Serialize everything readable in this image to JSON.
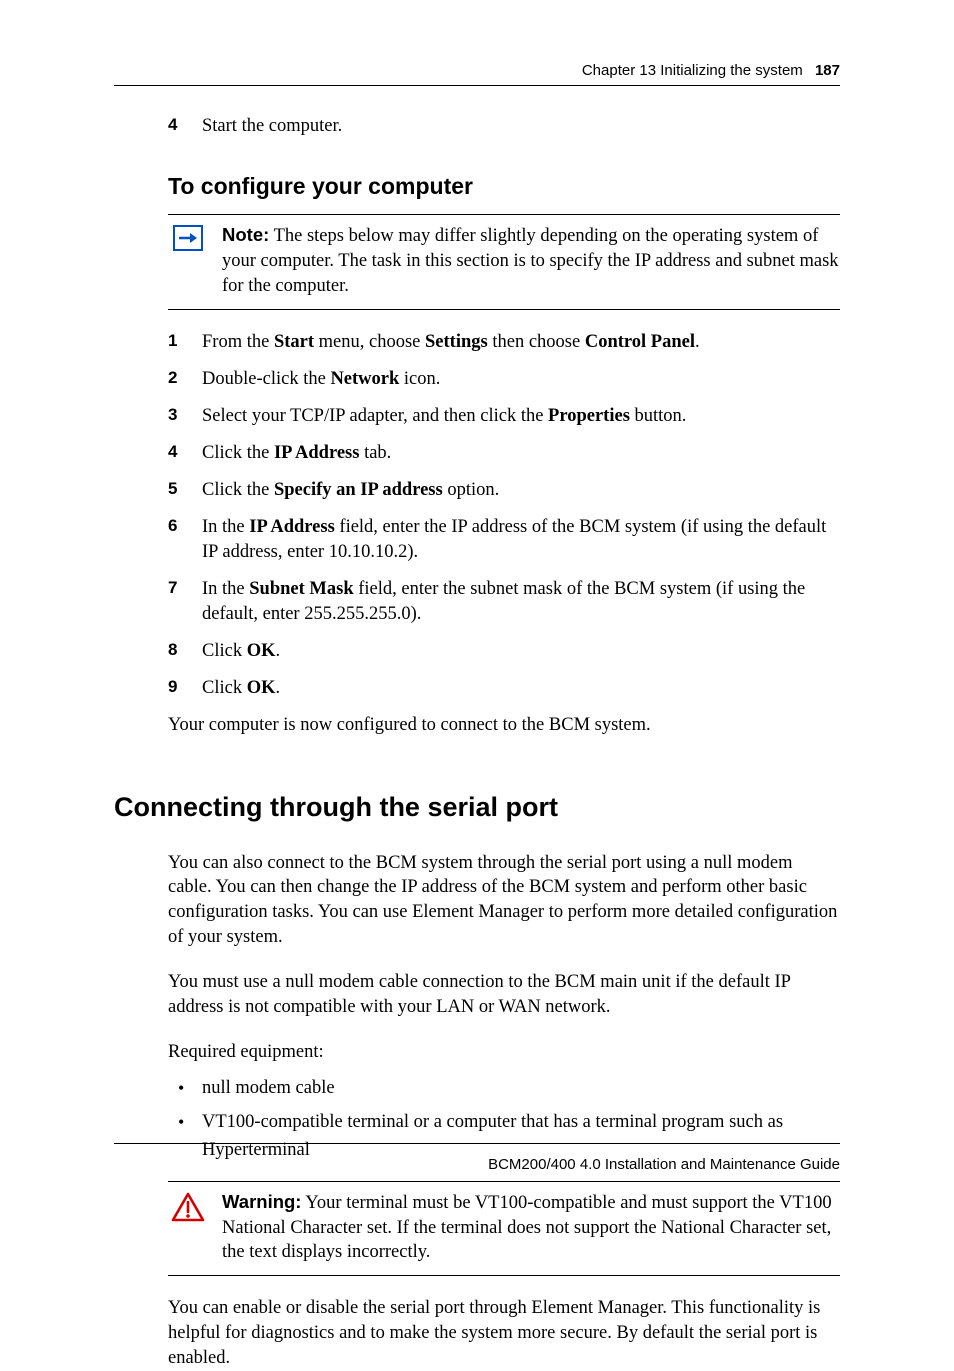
{
  "header": {
    "chapter": "Chapter 13  Initializing the system",
    "page_number": "187"
  },
  "pre_step": {
    "num": "4",
    "text": "Start the computer."
  },
  "section_configure": {
    "title": "To configure your computer",
    "note_lead": "Note:",
    "note_body": " The steps below may differ slightly depending on the operating system of your computer. The task in this section is to specify the IP address and subnet mask for the computer.",
    "steps": [
      {
        "num": "1",
        "pre": "From the ",
        "b1": "Start",
        "mid1": " menu, choose ",
        "b2": "Settings",
        "mid2": " then choose ",
        "b3": "Control Panel",
        "post": "."
      },
      {
        "num": "2",
        "pre": "Double-click the ",
        "b1": "Network",
        "post": " icon."
      },
      {
        "num": "3",
        "pre": "Select your TCP/IP adapter, and then click the ",
        "b1": "Properties",
        "post": " button."
      },
      {
        "num": "4",
        "pre": "Click the ",
        "b1": "IP Address",
        "post": " tab."
      },
      {
        "num": "5",
        "pre": "Click the ",
        "b1": "Specify an IP address",
        "post": " option."
      },
      {
        "num": "6",
        "pre": "In the ",
        "b1": "IP Address",
        "post": " field, enter the IP address of the BCM system (if using the default IP address, enter 10.10.10.2)."
      },
      {
        "num": "7",
        "pre": "In the ",
        "b1": "Subnet Mask",
        "post": " field, enter the subnet mask of the BCM system (if using the default, enter 255.255.255.0)."
      },
      {
        "num": "8",
        "pre": "Click ",
        "b1": "OK",
        "post": "."
      },
      {
        "num": "9",
        "pre": "Click ",
        "b1": "OK",
        "post": "."
      }
    ],
    "closing": "Your computer is now configured to connect to the BCM system."
  },
  "section_serial": {
    "title": "Connecting through the serial port",
    "p1": "You can also connect to the BCM system through the serial port using a null modem cable. You can then change the IP address of the BCM system and perform other basic configuration tasks. You can use Element Manager to perform more detailed configuration of your system.",
    "p2": "You must use a null modem cable connection to the BCM main unit if the default IP address is not compatible with your LAN or WAN network.",
    "req_label": "Required equipment:",
    "bullets": [
      "null modem cable",
      "VT100-compatible terminal or a computer that has a terminal program such as Hyperterminal"
    ],
    "warn_lead": "Warning:",
    "warn_body": " Your terminal must be VT100-compatible and must support the VT100 National Character set. If the terminal does not support the National Character set, the text displays incorrectly.",
    "p3": "You can enable or disable the serial port through Element Manager. This functionality is helpful for diagnostics and to make the system more secure. By default the serial port is enabled."
  },
  "footer": {
    "text": "BCM200/400 4.0 Installation and Maintenance Guide"
  }
}
